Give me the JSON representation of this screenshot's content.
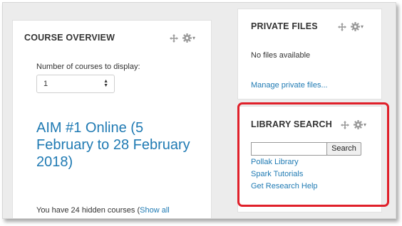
{
  "course_overview": {
    "title": "COURSE OVERVIEW",
    "courses_label": "Number of courses to display:",
    "courses_select_value": "1",
    "course_link": "AIM #1 Online (5 February to 28 February 2018)",
    "hidden_text": "You have 24 hidden courses (",
    "show_all": "Show all"
  },
  "private_files": {
    "title": "PRIVATE FILES",
    "empty_text": "No files available",
    "manage_link": "Manage private files..."
  },
  "library_search": {
    "title": "LIBRARY SEARCH",
    "search_button": "Search",
    "links": [
      "Pollak Library",
      "Spark Tutorials",
      "Get Research Help"
    ]
  },
  "colors": {
    "link": "#1f7ab3",
    "highlight": "#e0202a"
  },
  "icons": [
    "move-icon",
    "gear-icon",
    "caret-down-icon",
    "select-arrows-icon"
  ]
}
